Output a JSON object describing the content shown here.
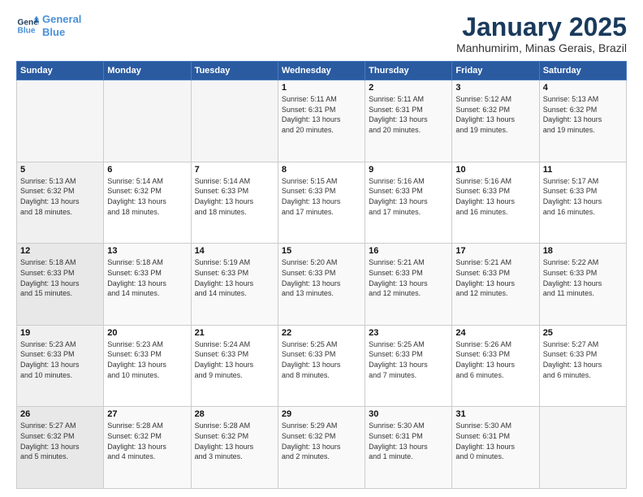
{
  "logo": {
    "line1": "General",
    "line2": "Blue"
  },
  "title": "January 2025",
  "subtitle": "Manhumirim, Minas Gerais, Brazil",
  "days_of_week": [
    "Sunday",
    "Monday",
    "Tuesday",
    "Wednesday",
    "Thursday",
    "Friday",
    "Saturday"
  ],
  "weeks": [
    [
      {
        "day": "",
        "info": ""
      },
      {
        "day": "",
        "info": ""
      },
      {
        "day": "",
        "info": ""
      },
      {
        "day": "1",
        "info": "Sunrise: 5:11 AM\nSunset: 6:31 PM\nDaylight: 13 hours\nand 20 minutes."
      },
      {
        "day": "2",
        "info": "Sunrise: 5:11 AM\nSunset: 6:31 PM\nDaylight: 13 hours\nand 20 minutes."
      },
      {
        "day": "3",
        "info": "Sunrise: 5:12 AM\nSunset: 6:32 PM\nDaylight: 13 hours\nand 19 minutes."
      },
      {
        "day": "4",
        "info": "Sunrise: 5:13 AM\nSunset: 6:32 PM\nDaylight: 13 hours\nand 19 minutes."
      }
    ],
    [
      {
        "day": "5",
        "info": "Sunrise: 5:13 AM\nSunset: 6:32 PM\nDaylight: 13 hours\nand 18 minutes."
      },
      {
        "day": "6",
        "info": "Sunrise: 5:14 AM\nSunset: 6:32 PM\nDaylight: 13 hours\nand 18 minutes."
      },
      {
        "day": "7",
        "info": "Sunrise: 5:14 AM\nSunset: 6:33 PM\nDaylight: 13 hours\nand 18 minutes."
      },
      {
        "day": "8",
        "info": "Sunrise: 5:15 AM\nSunset: 6:33 PM\nDaylight: 13 hours\nand 17 minutes."
      },
      {
        "day": "9",
        "info": "Sunrise: 5:16 AM\nSunset: 6:33 PM\nDaylight: 13 hours\nand 17 minutes."
      },
      {
        "day": "10",
        "info": "Sunrise: 5:16 AM\nSunset: 6:33 PM\nDaylight: 13 hours\nand 16 minutes."
      },
      {
        "day": "11",
        "info": "Sunrise: 5:17 AM\nSunset: 6:33 PM\nDaylight: 13 hours\nand 16 minutes."
      }
    ],
    [
      {
        "day": "12",
        "info": "Sunrise: 5:18 AM\nSunset: 6:33 PM\nDaylight: 13 hours\nand 15 minutes."
      },
      {
        "day": "13",
        "info": "Sunrise: 5:18 AM\nSunset: 6:33 PM\nDaylight: 13 hours\nand 14 minutes."
      },
      {
        "day": "14",
        "info": "Sunrise: 5:19 AM\nSunset: 6:33 PM\nDaylight: 13 hours\nand 14 minutes."
      },
      {
        "day": "15",
        "info": "Sunrise: 5:20 AM\nSunset: 6:33 PM\nDaylight: 13 hours\nand 13 minutes."
      },
      {
        "day": "16",
        "info": "Sunrise: 5:21 AM\nSunset: 6:33 PM\nDaylight: 13 hours\nand 12 minutes."
      },
      {
        "day": "17",
        "info": "Sunrise: 5:21 AM\nSunset: 6:33 PM\nDaylight: 13 hours\nand 12 minutes."
      },
      {
        "day": "18",
        "info": "Sunrise: 5:22 AM\nSunset: 6:33 PM\nDaylight: 13 hours\nand 11 minutes."
      }
    ],
    [
      {
        "day": "19",
        "info": "Sunrise: 5:23 AM\nSunset: 6:33 PM\nDaylight: 13 hours\nand 10 minutes."
      },
      {
        "day": "20",
        "info": "Sunrise: 5:23 AM\nSunset: 6:33 PM\nDaylight: 13 hours\nand 10 minutes."
      },
      {
        "day": "21",
        "info": "Sunrise: 5:24 AM\nSunset: 6:33 PM\nDaylight: 13 hours\nand 9 minutes."
      },
      {
        "day": "22",
        "info": "Sunrise: 5:25 AM\nSunset: 6:33 PM\nDaylight: 13 hours\nand 8 minutes."
      },
      {
        "day": "23",
        "info": "Sunrise: 5:25 AM\nSunset: 6:33 PM\nDaylight: 13 hours\nand 7 minutes."
      },
      {
        "day": "24",
        "info": "Sunrise: 5:26 AM\nSunset: 6:33 PM\nDaylight: 13 hours\nand 6 minutes."
      },
      {
        "day": "25",
        "info": "Sunrise: 5:27 AM\nSunset: 6:33 PM\nDaylight: 13 hours\nand 6 minutes."
      }
    ],
    [
      {
        "day": "26",
        "info": "Sunrise: 5:27 AM\nSunset: 6:32 PM\nDaylight: 13 hours\nand 5 minutes."
      },
      {
        "day": "27",
        "info": "Sunrise: 5:28 AM\nSunset: 6:32 PM\nDaylight: 13 hours\nand 4 minutes."
      },
      {
        "day": "28",
        "info": "Sunrise: 5:28 AM\nSunset: 6:32 PM\nDaylight: 13 hours\nand 3 minutes."
      },
      {
        "day": "29",
        "info": "Sunrise: 5:29 AM\nSunset: 6:32 PM\nDaylight: 13 hours\nand 2 minutes."
      },
      {
        "day": "30",
        "info": "Sunrise: 5:30 AM\nSunset: 6:31 PM\nDaylight: 13 hours\nand 1 minute."
      },
      {
        "day": "31",
        "info": "Sunrise: 5:30 AM\nSunset: 6:31 PM\nDaylight: 13 hours\nand 0 minutes."
      },
      {
        "day": "",
        "info": ""
      }
    ]
  ]
}
